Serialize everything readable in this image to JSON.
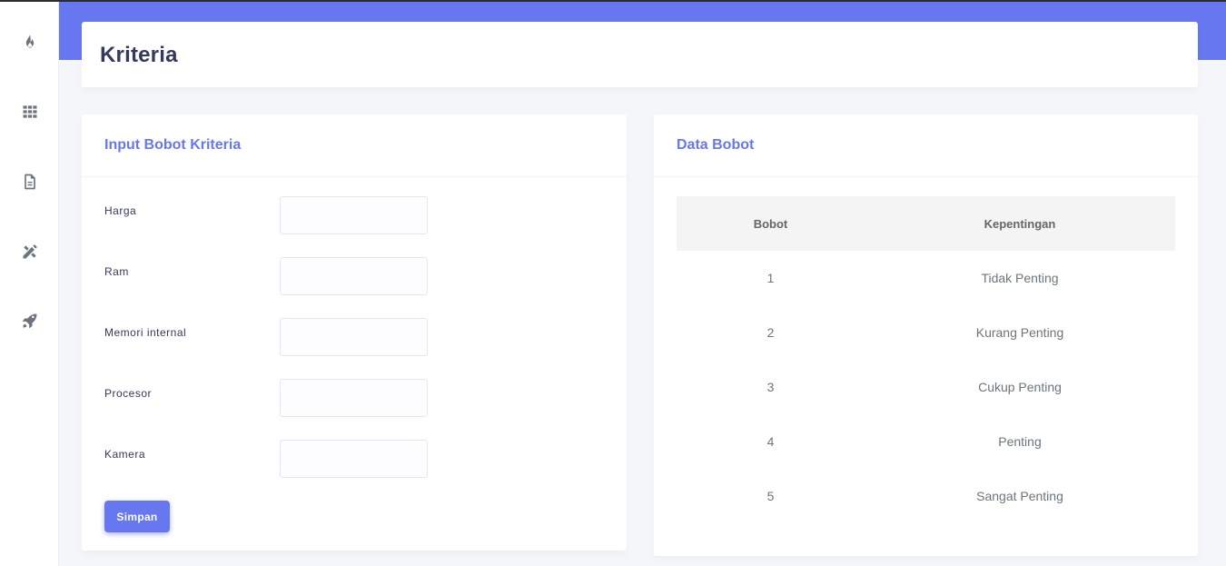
{
  "page": {
    "title": "Kriteria"
  },
  "sidebar": {
    "items": [
      {
        "icon": "fire-icon"
      },
      {
        "icon": "grid-icon"
      },
      {
        "icon": "document-icon"
      },
      {
        "icon": "pencil-ruler-icon"
      },
      {
        "icon": "rocket-icon"
      }
    ]
  },
  "form": {
    "title": "Input Bobot Kriteria",
    "fields": [
      {
        "label": "Harga",
        "value": ""
      },
      {
        "label": "Ram",
        "value": ""
      },
      {
        "label": "Memori internal",
        "value": ""
      },
      {
        "label": "Procesor",
        "value": ""
      },
      {
        "label": "Kamera",
        "value": ""
      }
    ],
    "submit_label": "Simpan"
  },
  "data": {
    "title": "Data Bobot",
    "columns": [
      "Bobot",
      "Kepentingan"
    ],
    "rows": [
      [
        "1",
        "Tidak Penting"
      ],
      [
        "2",
        "Kurang Penting"
      ],
      [
        "3",
        "Cukup Penting"
      ],
      [
        "4",
        "Penting"
      ],
      [
        "5",
        "Sangat Penting"
      ]
    ]
  },
  "colors": {
    "accent": "#6777ef",
    "background": "#f4f6f9"
  }
}
